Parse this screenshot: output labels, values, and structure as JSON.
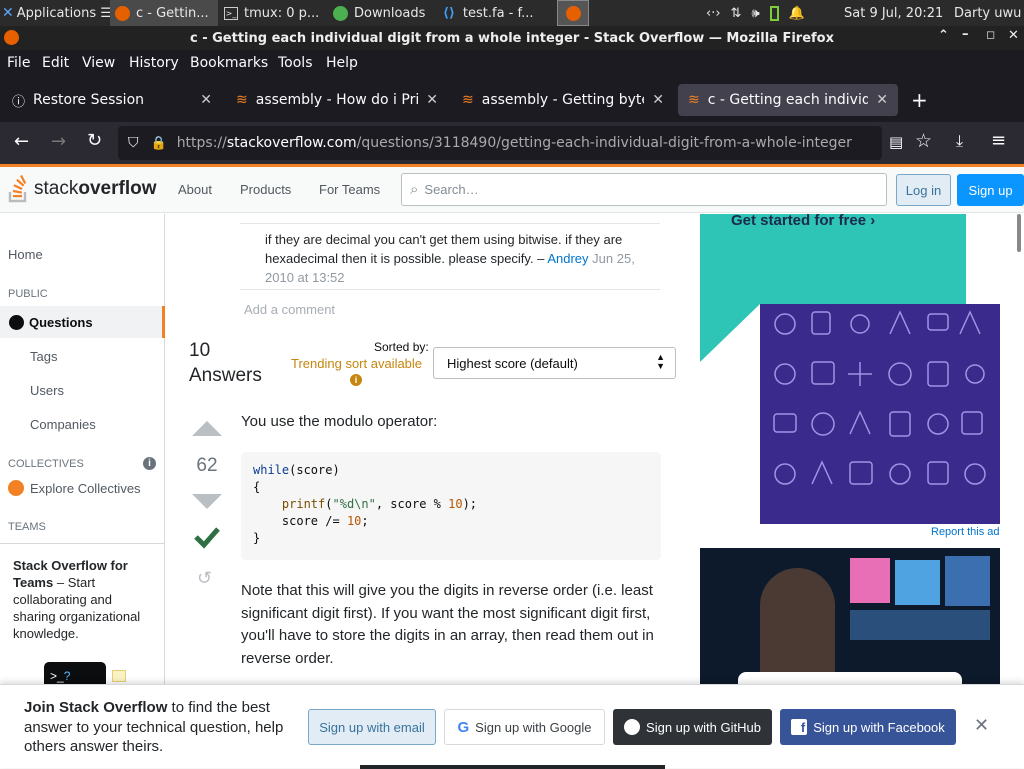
{
  "taskbar": {
    "items": [
      {
        "label": "Applications ☰"
      },
      {
        "label": "c - Gettin..."
      },
      {
        "label": "tmux: 0 p..."
      },
      {
        "label": "Downloads"
      },
      {
        "label": "test.fa - f..."
      }
    ],
    "clock": "Sat  9 Jul, 20:21",
    "user": "Darty uwu"
  },
  "window": {
    "title": "c - Getting each individual digit from a whole integer - Stack Overflow — Mozilla Firefox"
  },
  "menu": [
    "File",
    "Edit",
    "View",
    "History",
    "Bookmarks",
    "Tools",
    "Help"
  ],
  "tabs": [
    {
      "label": "Restore Session"
    },
    {
      "label": "assembly - How do i Print"
    },
    {
      "label": "assembly - Getting bytes"
    },
    {
      "label": "c - Getting each individual"
    }
  ],
  "url": {
    "domain": "stackoverflow.com",
    "prefix": "https://",
    "path": "/questions/3118490/getting-each-individual-digit-from-a-whole-integer"
  },
  "so": {
    "logo_a": "stack",
    "logo_b": "overflow",
    "nav": [
      "About",
      "Products",
      "For Teams"
    ],
    "search_placeholder": "Search…",
    "login": "Log in",
    "signup": "Sign up"
  },
  "sidebar": {
    "home": "Home",
    "public": "PUBLIC",
    "questions": "Questions",
    "tags": "Tags",
    "users": "Users",
    "companies": "Companies",
    "collectives": "COLLECTIVES",
    "explore": "Explore Collectives",
    "teams": "TEAMS",
    "teams_title": "Stack Overflow for Teams",
    "teams_desc": " – Start collaborating and sharing organizational knowledge."
  },
  "comment": {
    "text": "if they are decimal you can't get them using bitwise. if they are hexadecimal then it is possible. please specify. –",
    "author": "Andrey",
    "date": "Jun 25, 2010 at 13:52",
    "add": "Add a comment"
  },
  "answers": {
    "count": "10",
    "label": "Answers",
    "sorted_by": "Sorted by:",
    "trending": "Trending sort available",
    "sort_value": "Highest score (default)"
  },
  "answer": {
    "score": "62",
    "intro": "You use the modulo operator:",
    "code": {
      "kw": "while",
      "l1": "(score)",
      "l2": "{",
      "fn": "printf",
      "str": "\"%d\\n\"",
      "l3mid": ", score % ",
      "n1": "10",
      "l3end": ");",
      "l4": "score /= ",
      "n2": "10",
      "l4end": ";",
      "l5": "}"
    },
    "body": "Note that this will give you the digits in reverse order (i.e. least significant digit first). If you want the most significant digit first, you'll have to store the digits in an array, then read them out in reverse order."
  },
  "ad": {
    "cta": "Get started for free ›",
    "report": "Report this ad"
  },
  "banner": {
    "bold": "Join Stack Overflow",
    "text": " to find the best answer to your technical question, help others answer theirs.",
    "email": "Sign up with email",
    "google": "Sign up with Google",
    "github": "Sign up with GitHub",
    "facebook": "Sign up with Facebook"
  },
  "colors": {
    "so_orange": "#f48024",
    "link_blue": "#0074cc",
    "accept_green": "#2f6f44",
    "ad_teal": "#2ec4b6",
    "ad_indigo": "#3a2a8c"
  }
}
